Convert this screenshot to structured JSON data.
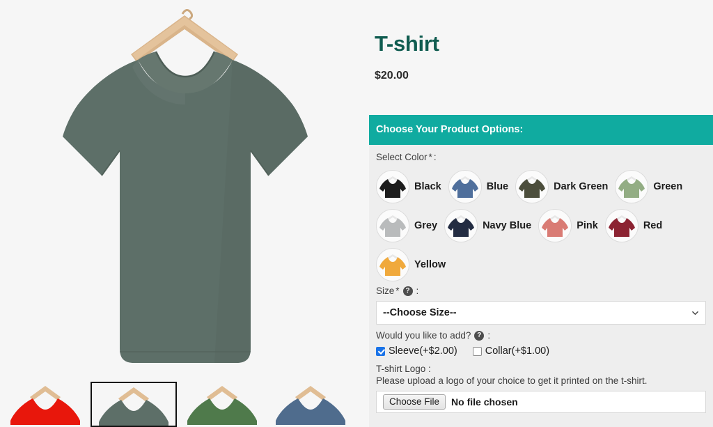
{
  "product": {
    "title": "T-shirt",
    "price": "$20.00",
    "main_image_alt": "dark-green-tshirt-on-hanger",
    "main_image_color": "#5d6f68"
  },
  "gallery": {
    "thumbnails": [
      {
        "name": "thumb-red",
        "color": "#e8170c",
        "selected": false
      },
      {
        "name": "thumb-dark-green",
        "color": "#5d6f68",
        "selected": true
      },
      {
        "name": "thumb-green",
        "color": "#4f7a4b",
        "selected": false
      },
      {
        "name": "thumb-blue",
        "color": "#4f6c8d",
        "selected": false
      }
    ]
  },
  "options": {
    "header": "Choose Your Product Options:",
    "accent_color": "#10aba0",
    "panel_bg": "#eeeeee",
    "color_field": {
      "label": "Select Color",
      "required_mark": "*",
      "suffix": ":",
      "swatches": [
        {
          "label": "Black",
          "color": "#1d1d1d"
        },
        {
          "label": "Blue",
          "color": "#4f6f9c"
        },
        {
          "label": "Dark Green",
          "color": "#4c4e3c"
        },
        {
          "label": "Green",
          "color": "#93ad84"
        },
        {
          "label": "Grey",
          "color": "#b9bbbc"
        },
        {
          "label": "Navy Blue",
          "color": "#232c42"
        },
        {
          "label": "Pink",
          "color": "#d97b74"
        },
        {
          "label": "Red",
          "color": "#8c2332"
        },
        {
          "label": "Yellow",
          "color": "#f0a93c"
        }
      ]
    },
    "size_field": {
      "label": "Size",
      "required_mark": "*",
      "suffix": ":",
      "help_icon": "question-mark-icon",
      "selected": "--Choose Size--",
      "choices": [
        "--Choose Size--"
      ]
    },
    "addons_field": {
      "label": "Would you like to add?",
      "suffix": ":",
      "help_icon": "question-mark-icon",
      "items": [
        {
          "label": "Sleeve(+$2.00)",
          "checked": true
        },
        {
          "label": "Collar(+$1.00)",
          "checked": false
        }
      ]
    },
    "logo_field": {
      "label": "T-shirt Logo :",
      "instruction": "Please upload a logo of your choice to get it printed on the t-shirt.",
      "button_label": "Choose File",
      "status": "No file chosen"
    }
  }
}
